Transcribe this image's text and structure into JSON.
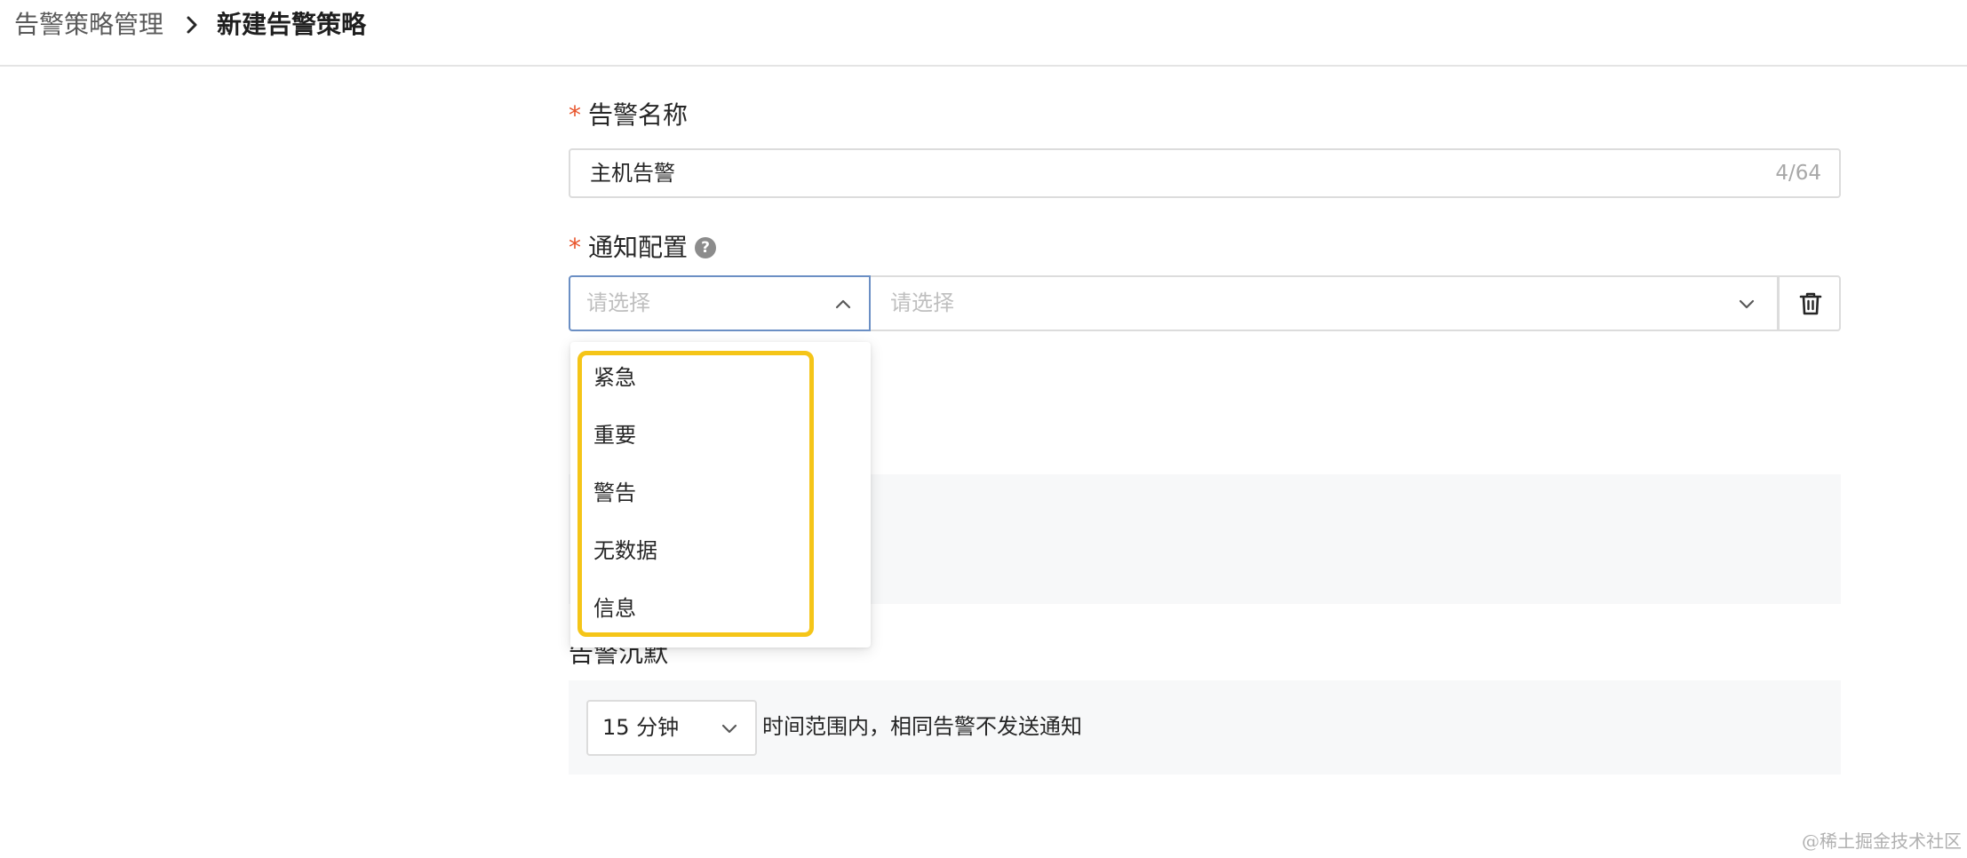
{
  "breadcrumb": {
    "parent": "告警策略管理",
    "current": "新建告警策略"
  },
  "form": {
    "name_field": {
      "label": "告警名称",
      "value": "主机告警",
      "char_count": "4/64"
    },
    "notify_config": {
      "label": "通知配置",
      "select_placeholder": "请选择",
      "target_placeholder": "请选择"
    },
    "severity_dropdown": {
      "options": [
        "紧急",
        "重要",
        "警告",
        "无数据",
        "信息"
      ]
    },
    "silence": {
      "label": "告警沉默",
      "duration": "15 分钟",
      "description": "时间范围内，相同告警不发送通知"
    }
  },
  "watermark": "@稀土掘金技术社区",
  "colors": {
    "required_mark": "#e8542b",
    "highlight_box": "#f5c518",
    "focus_border": "#6b8fc4"
  }
}
